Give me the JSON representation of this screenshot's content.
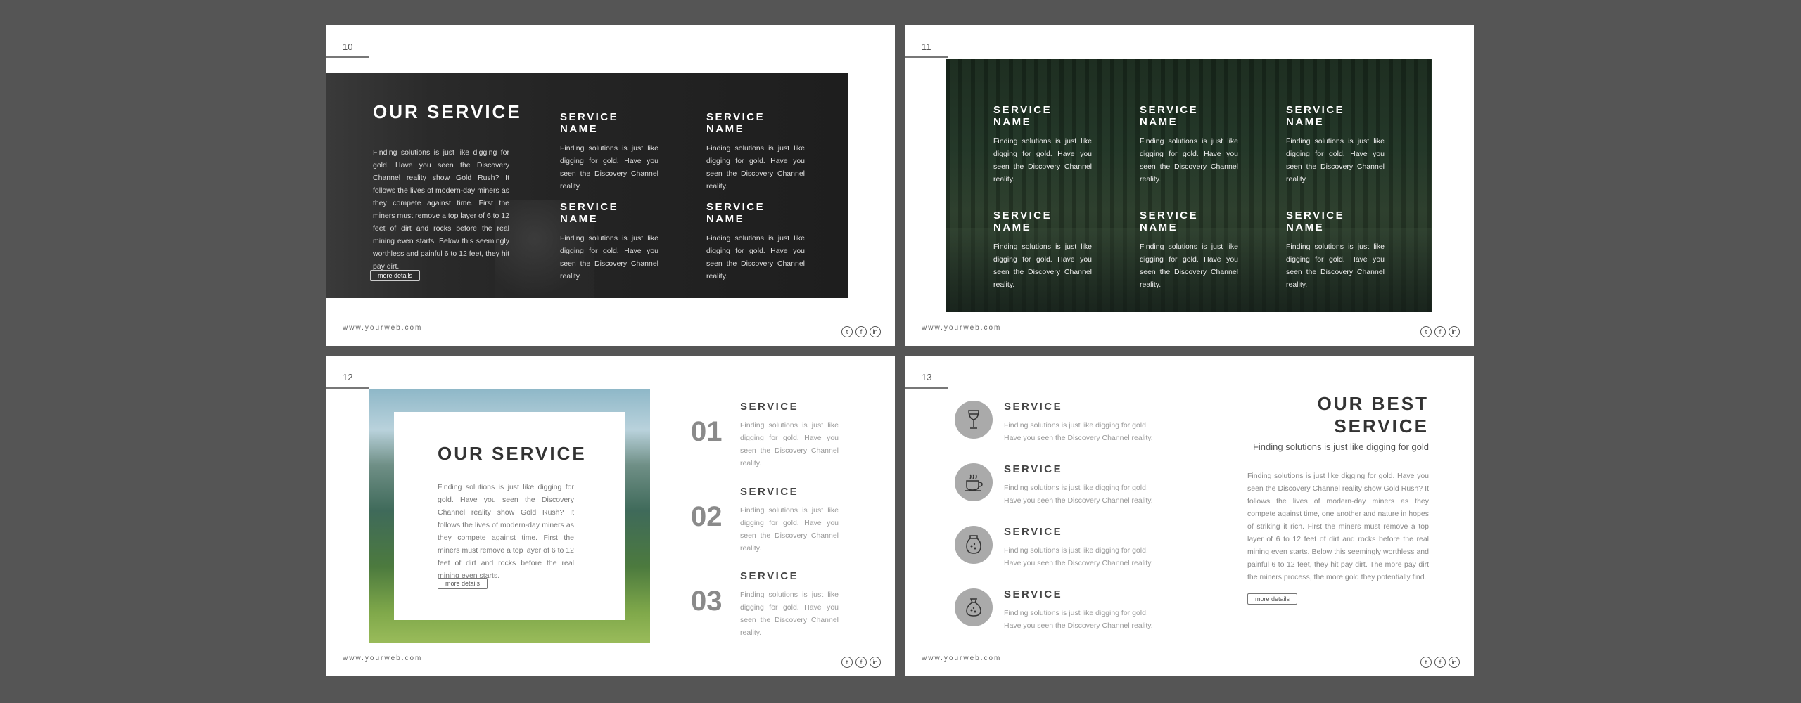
{
  "common": {
    "url": "www.yourweb.com",
    "social": [
      "twitter-icon",
      "facebook-icon",
      "linkedin-icon"
    ]
  },
  "slide10": {
    "number": "10",
    "heading": "OUR SERVICE",
    "intro": "Finding solutions is just like digging for gold. Have you seen the Discovery Channel reality show Gold Rush? It follows the lives of modern-day miners as they compete against time. First the miners must remove a top layer of 6 to 12 feet of dirt and rocks before the real mining even starts. Below this seemingly worthless and painful 6 to 12 feet, they hit pay dirt.",
    "button": "more details",
    "services": [
      {
        "title": "SERVICE NAME",
        "text": "Finding solutions is just like digging for gold. Have you seen the Discovery Channel reality."
      },
      {
        "title": "SERVICE NAME",
        "text": "Finding solutions is just like digging for gold. Have you seen the Discovery Channel reality."
      },
      {
        "title": "SERVICE NAME",
        "text": "Finding solutions is just like digging for gold. Have you seen the Discovery Channel reality."
      },
      {
        "title": "SERVICE NAME",
        "text": "Finding solutions is just like digging for gold. Have you seen the Discovery Channel reality."
      }
    ]
  },
  "slide11": {
    "number": "11",
    "services": [
      {
        "title": "SERVICE NAME",
        "text": "Finding solutions is just like digging for gold. Have you seen the Discovery Channel reality."
      },
      {
        "title": "SERVICE NAME",
        "text": "Finding solutions is just like digging for gold. Have you seen the Discovery Channel reality."
      },
      {
        "title": "SERVICE NAME",
        "text": "Finding solutions is just like digging for gold. Have you seen the Discovery Channel reality."
      },
      {
        "title": "SERVICE NAME",
        "text": "Finding solutions is just like digging for gold. Have you seen the Discovery Channel reality."
      },
      {
        "title": "SERVICE NAME",
        "text": "Finding solutions is just like digging for gold. Have you seen the Discovery Channel reality."
      },
      {
        "title": "SERVICE NAME",
        "text": "Finding solutions is just like digging for gold. Have you seen the Discovery Channel reality."
      }
    ]
  },
  "slide12": {
    "number": "12",
    "heading": "OUR SERVICE",
    "intro": "Finding solutions is just like digging for gold. Have you seen the Discovery Channel reality show Gold Rush? It follows the lives of modern-day miners as they compete against time. First the miners must remove a top layer of 6 to 12 feet of dirt and rocks before the real mining even starts.",
    "button": "more details",
    "items": [
      {
        "num": "01",
        "title": "SERVICE",
        "text": "Finding solutions is just like digging for gold. Have you seen the Discovery Channel reality."
      },
      {
        "num": "02",
        "title": "SERVICE",
        "text": "Finding solutions is just like digging for gold. Have you seen the Discovery Channel reality."
      },
      {
        "num": "03",
        "title": "SERVICE",
        "text": "Finding solutions is just like digging for gold. Have you seen the Discovery Channel reality."
      }
    ]
  },
  "slide13": {
    "number": "13",
    "heading": "OUR BEST SERVICE",
    "subheading": "Finding solutions is just like digging for gold",
    "body": "Finding solutions is just like digging for gold. Have you seen the Discovery Channel reality show Gold Rush? It follows the lives of modern-day miners as they compete against time, one another and nature in hopes of striking it rich. First the miners must remove a top layer of 6 to 12 feet of dirt and rocks before the real mining even starts. Below this seemingly worthless and painful 6 to 12 feet, they hit pay dirt. The more pay dirt the miners process, the more gold they potentially find.",
    "button": "more details",
    "items": [
      {
        "icon": "wine-glass-icon",
        "title": "SERVICE",
        "text": "Finding solutions is just like digging for gold. Have you seen the Discovery Channel reality."
      },
      {
        "icon": "coffee-cup-icon",
        "title": "SERVICE",
        "text": "Finding solutions is just like digging for gold. Have you seen the Discovery Channel reality."
      },
      {
        "icon": "jar-icon",
        "title": "SERVICE",
        "text": "Finding solutions is just like digging for gold. Have you seen the Discovery Channel reality."
      },
      {
        "icon": "bag-icon",
        "title": "SERVICE",
        "text": "Finding solutions is just like digging for gold. Have you seen the Discovery Channel reality."
      }
    ]
  }
}
